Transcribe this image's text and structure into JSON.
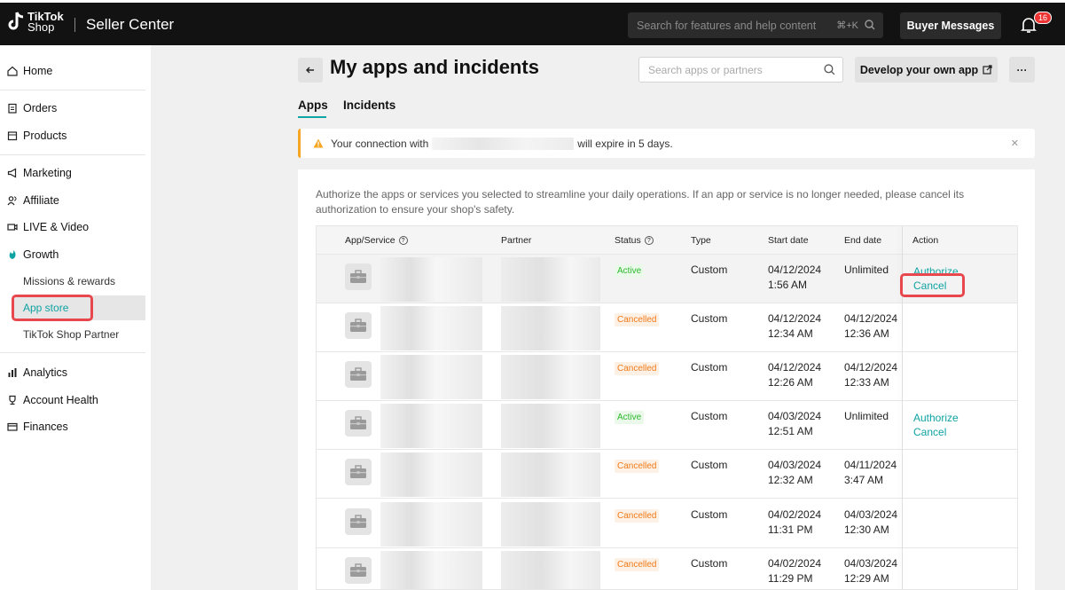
{
  "topbar": {
    "brand_line1": "TikTok",
    "brand_line2": "Shop",
    "product": "Seller Center",
    "search_placeholder": "Search for features and help content",
    "search_shortcut": "⌘+K",
    "buyer_messages": "Buyer Messages",
    "notification_count": "16"
  },
  "sidebar": {
    "items": [
      {
        "label": "Home",
        "icon": "home-icon"
      },
      {
        "label": "Orders",
        "icon": "clipboard-icon"
      },
      {
        "label": "Products",
        "icon": "box-icon"
      },
      {
        "label": "Marketing",
        "icon": "megaphone-icon"
      },
      {
        "label": "Affiliate",
        "icon": "people-icon"
      },
      {
        "label": "LIVE & Video",
        "icon": "video-icon"
      },
      {
        "label": "Growth",
        "icon": "growth-icon"
      },
      {
        "label": "Analytics",
        "icon": "chart-icon"
      },
      {
        "label": "Account Health",
        "icon": "trophy-icon"
      },
      {
        "label": "Finances",
        "icon": "card-icon"
      }
    ],
    "growth_sub": [
      "Missions & rewards",
      "App store",
      "TikTok Shop Partner"
    ]
  },
  "page": {
    "title": "My apps and incidents",
    "search_placeholder": "Search apps or partners",
    "develop_button": "Develop your own app",
    "tabs": [
      "Apps",
      "Incidents"
    ],
    "alert_prefix": "Your connection with",
    "alert_suffix": "will expire in 5 days.",
    "description": "Authorize the apps or services you selected to streamline your daily operations. If an app or service is no longer needed, please cancel its authorization to ensure your shop's safety."
  },
  "table": {
    "headers": [
      "App/Service",
      "Partner",
      "Status",
      "Type",
      "Start date",
      "End date",
      "Action"
    ],
    "rows": [
      {
        "status": "Active",
        "type": "Custom",
        "start_date": "04/12/2024",
        "start_time": "1:56 AM",
        "end_date": "Unlimited",
        "end_time": "",
        "actions": [
          "Authorize",
          "Cancel"
        ]
      },
      {
        "status": "Cancelled",
        "type": "Custom",
        "start_date": "04/12/2024",
        "start_time": "12:34 AM",
        "end_date": "04/12/2024",
        "end_time": "12:36 AM",
        "actions": []
      },
      {
        "status": "Cancelled",
        "type": "Custom",
        "start_date": "04/12/2024",
        "start_time": "12:26 AM",
        "end_date": "04/12/2024",
        "end_time": "12:33 AM",
        "actions": []
      },
      {
        "status": "Active",
        "type": "Custom",
        "start_date": "04/03/2024",
        "start_time": "12:51 AM",
        "end_date": "Unlimited",
        "end_time": "",
        "actions": [
          "Authorize",
          "Cancel"
        ]
      },
      {
        "status": "Cancelled",
        "type": "Custom",
        "start_date": "04/03/2024",
        "start_time": "12:32 AM",
        "end_date": "04/11/2024",
        "end_time": "3:47 AM",
        "actions": []
      },
      {
        "status": "Cancelled",
        "type": "Custom",
        "start_date": "04/02/2024",
        "start_time": "11:31 PM",
        "end_date": "04/03/2024",
        "end_time": "12:30 AM",
        "actions": []
      },
      {
        "status": "Cancelled",
        "type": "Custom",
        "start_date": "04/02/2024",
        "start_time": "11:29 PM",
        "end_date": "04/03/2024",
        "end_time": "12:29 AM",
        "actions": []
      }
    ]
  },
  "colors": {
    "accent": "#0fa3a3",
    "highlight": "#e8474d",
    "warning": "#f5a623"
  }
}
